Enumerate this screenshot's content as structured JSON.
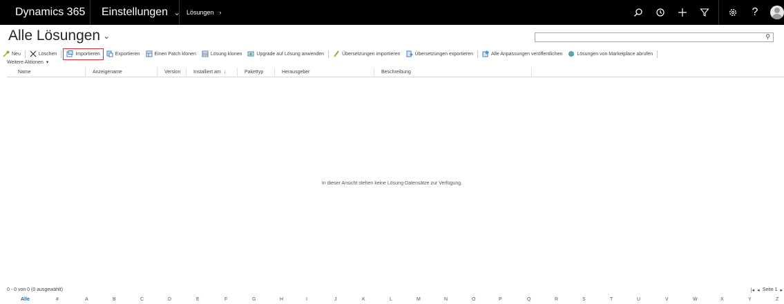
{
  "nav": {
    "app_title": "Dynamics 365",
    "area": "Einstellungen",
    "breadcrumb": "Lösungen",
    "icons": [
      "search-icon",
      "recent-icon",
      "plus-icon",
      "filter-icon",
      "gear-icon",
      "help-icon",
      "avatar"
    ]
  },
  "page": {
    "title": "Alle Lösungen",
    "search_value": ""
  },
  "commands": [
    {
      "label": "Neu",
      "icon": "new-icon"
    },
    {
      "label": "Löschen",
      "icon": "delete-icon"
    },
    {
      "label": "Importieren",
      "icon": "import-icon"
    },
    {
      "label": "Exportieren",
      "icon": "export-icon"
    },
    {
      "label": "Einen Patch klonen",
      "icon": "clone-patch-icon"
    },
    {
      "label": "Lösung klonen",
      "icon": "clone-solution-icon"
    },
    {
      "label": "Upgrade auf Lösung anwenden",
      "icon": "upgrade-icon"
    },
    {
      "label": "Übersetzungen importieren",
      "icon": "import-translations-icon"
    },
    {
      "label": "Übersetzungen exportieren",
      "icon": "export-translations-icon"
    },
    {
      "label": "Alle Anpassungen veröffentlichen",
      "icon": "publish-icon"
    },
    {
      "label": "Lösungen von Marketplace abrufen",
      "icon": "marketplace-icon"
    }
  ],
  "more_actions": "Weitere Aktionen",
  "columns": [
    "Name",
    "Anzeigename",
    "Version",
    "Installiert am",
    "Pakettyp",
    "Herausgeber",
    "Beschreibung"
  ],
  "empty_message": "In dieser Ansicht stehen keine Lösung-Datensätze zur Verfügung.",
  "footer": {
    "status": "0 - 0 von 0 (0 ausgewählt)",
    "page_label": "Seite 1"
  },
  "jump_letters": [
    "Alle",
    "#",
    "A",
    "B",
    "C",
    "D",
    "E",
    "F",
    "G",
    "H",
    "I",
    "J",
    "K",
    "L",
    "M",
    "N",
    "O",
    "P",
    "Q",
    "R",
    "S",
    "T",
    "U",
    "V",
    "W",
    "X",
    "Y",
    "Z"
  ],
  "colors": {
    "nav_bg": "#000000",
    "highlight": "#e0262b",
    "link": "#1160b7"
  }
}
